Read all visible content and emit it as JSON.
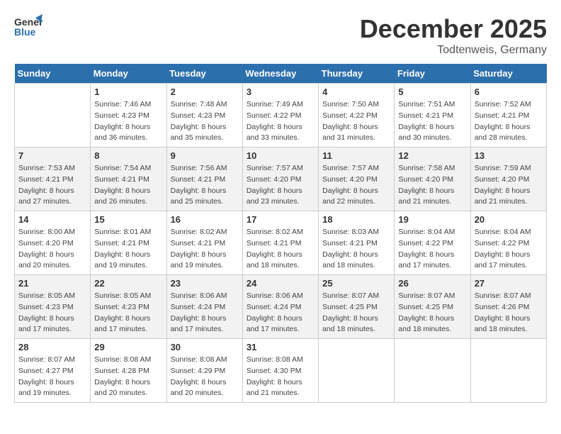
{
  "header": {
    "logo_general": "General",
    "logo_blue": "Blue",
    "month": "December 2025",
    "location": "Todtenweis, Germany"
  },
  "days_of_week": [
    "Sunday",
    "Monday",
    "Tuesday",
    "Wednesday",
    "Thursday",
    "Friday",
    "Saturday"
  ],
  "weeks": [
    [
      {
        "day": "",
        "sunrise": "",
        "sunset": "",
        "daylight": ""
      },
      {
        "day": "1",
        "sunrise": "Sunrise: 7:46 AM",
        "sunset": "Sunset: 4:23 PM",
        "daylight": "Daylight: 8 hours and 36 minutes."
      },
      {
        "day": "2",
        "sunrise": "Sunrise: 7:48 AM",
        "sunset": "Sunset: 4:23 PM",
        "daylight": "Daylight: 8 hours and 35 minutes."
      },
      {
        "day": "3",
        "sunrise": "Sunrise: 7:49 AM",
        "sunset": "Sunset: 4:22 PM",
        "daylight": "Daylight: 8 hours and 33 minutes."
      },
      {
        "day": "4",
        "sunrise": "Sunrise: 7:50 AM",
        "sunset": "Sunset: 4:22 PM",
        "daylight": "Daylight: 8 hours and 31 minutes."
      },
      {
        "day": "5",
        "sunrise": "Sunrise: 7:51 AM",
        "sunset": "Sunset: 4:21 PM",
        "daylight": "Daylight: 8 hours and 30 minutes."
      },
      {
        "day": "6",
        "sunrise": "Sunrise: 7:52 AM",
        "sunset": "Sunset: 4:21 PM",
        "daylight": "Daylight: 8 hours and 28 minutes."
      }
    ],
    [
      {
        "day": "7",
        "sunrise": "Sunrise: 7:53 AM",
        "sunset": "Sunset: 4:21 PM",
        "daylight": "Daylight: 8 hours and 27 minutes."
      },
      {
        "day": "8",
        "sunrise": "Sunrise: 7:54 AM",
        "sunset": "Sunset: 4:21 PM",
        "daylight": "Daylight: 8 hours and 26 minutes."
      },
      {
        "day": "9",
        "sunrise": "Sunrise: 7:56 AM",
        "sunset": "Sunset: 4:21 PM",
        "daylight": "Daylight: 8 hours and 25 minutes."
      },
      {
        "day": "10",
        "sunrise": "Sunrise: 7:57 AM",
        "sunset": "Sunset: 4:20 PM",
        "daylight": "Daylight: 8 hours and 23 minutes."
      },
      {
        "day": "11",
        "sunrise": "Sunrise: 7:57 AM",
        "sunset": "Sunset: 4:20 PM",
        "daylight": "Daylight: 8 hours and 22 minutes."
      },
      {
        "day": "12",
        "sunrise": "Sunrise: 7:58 AM",
        "sunset": "Sunset: 4:20 PM",
        "daylight": "Daylight: 8 hours and 21 minutes."
      },
      {
        "day": "13",
        "sunrise": "Sunrise: 7:59 AM",
        "sunset": "Sunset: 4:20 PM",
        "daylight": "Daylight: 8 hours and 21 minutes."
      }
    ],
    [
      {
        "day": "14",
        "sunrise": "Sunrise: 8:00 AM",
        "sunset": "Sunset: 4:20 PM",
        "daylight": "Daylight: 8 hours and 20 minutes."
      },
      {
        "day": "15",
        "sunrise": "Sunrise: 8:01 AM",
        "sunset": "Sunset: 4:21 PM",
        "daylight": "Daylight: 8 hours and 19 minutes."
      },
      {
        "day": "16",
        "sunrise": "Sunrise: 8:02 AM",
        "sunset": "Sunset: 4:21 PM",
        "daylight": "Daylight: 8 hours and 19 minutes."
      },
      {
        "day": "17",
        "sunrise": "Sunrise: 8:02 AM",
        "sunset": "Sunset: 4:21 PM",
        "daylight": "Daylight: 8 hours and 18 minutes."
      },
      {
        "day": "18",
        "sunrise": "Sunrise: 8:03 AM",
        "sunset": "Sunset: 4:21 PM",
        "daylight": "Daylight: 8 hours and 18 minutes."
      },
      {
        "day": "19",
        "sunrise": "Sunrise: 8:04 AM",
        "sunset": "Sunset: 4:22 PM",
        "daylight": "Daylight: 8 hours and 17 minutes."
      },
      {
        "day": "20",
        "sunrise": "Sunrise: 8:04 AM",
        "sunset": "Sunset: 4:22 PM",
        "daylight": "Daylight: 8 hours and 17 minutes."
      }
    ],
    [
      {
        "day": "21",
        "sunrise": "Sunrise: 8:05 AM",
        "sunset": "Sunset: 4:23 PM",
        "daylight": "Daylight: 8 hours and 17 minutes."
      },
      {
        "day": "22",
        "sunrise": "Sunrise: 8:05 AM",
        "sunset": "Sunset: 4:23 PM",
        "daylight": "Daylight: 8 hours and 17 minutes."
      },
      {
        "day": "23",
        "sunrise": "Sunrise: 8:06 AM",
        "sunset": "Sunset: 4:24 PM",
        "daylight": "Daylight: 8 hours and 17 minutes."
      },
      {
        "day": "24",
        "sunrise": "Sunrise: 8:06 AM",
        "sunset": "Sunset: 4:24 PM",
        "daylight": "Daylight: 8 hours and 17 minutes."
      },
      {
        "day": "25",
        "sunrise": "Sunrise: 8:07 AM",
        "sunset": "Sunset: 4:25 PM",
        "daylight": "Daylight: 8 hours and 18 minutes."
      },
      {
        "day": "26",
        "sunrise": "Sunrise: 8:07 AM",
        "sunset": "Sunset: 4:25 PM",
        "daylight": "Daylight: 8 hours and 18 minutes."
      },
      {
        "day": "27",
        "sunrise": "Sunrise: 8:07 AM",
        "sunset": "Sunset: 4:26 PM",
        "daylight": "Daylight: 8 hours and 18 minutes."
      }
    ],
    [
      {
        "day": "28",
        "sunrise": "Sunrise: 8:07 AM",
        "sunset": "Sunset: 4:27 PM",
        "daylight": "Daylight: 8 hours and 19 minutes."
      },
      {
        "day": "29",
        "sunrise": "Sunrise: 8:08 AM",
        "sunset": "Sunset: 4:28 PM",
        "daylight": "Daylight: 8 hours and 20 minutes."
      },
      {
        "day": "30",
        "sunrise": "Sunrise: 8:08 AM",
        "sunset": "Sunset: 4:29 PM",
        "daylight": "Daylight: 8 hours and 20 minutes."
      },
      {
        "day": "31",
        "sunrise": "Sunrise: 8:08 AM",
        "sunset": "Sunset: 4:30 PM",
        "daylight": "Daylight: 8 hours and 21 minutes."
      },
      {
        "day": "",
        "sunrise": "",
        "sunset": "",
        "daylight": ""
      },
      {
        "day": "",
        "sunrise": "",
        "sunset": "",
        "daylight": ""
      },
      {
        "day": "",
        "sunrise": "",
        "sunset": "",
        "daylight": ""
      }
    ]
  ]
}
